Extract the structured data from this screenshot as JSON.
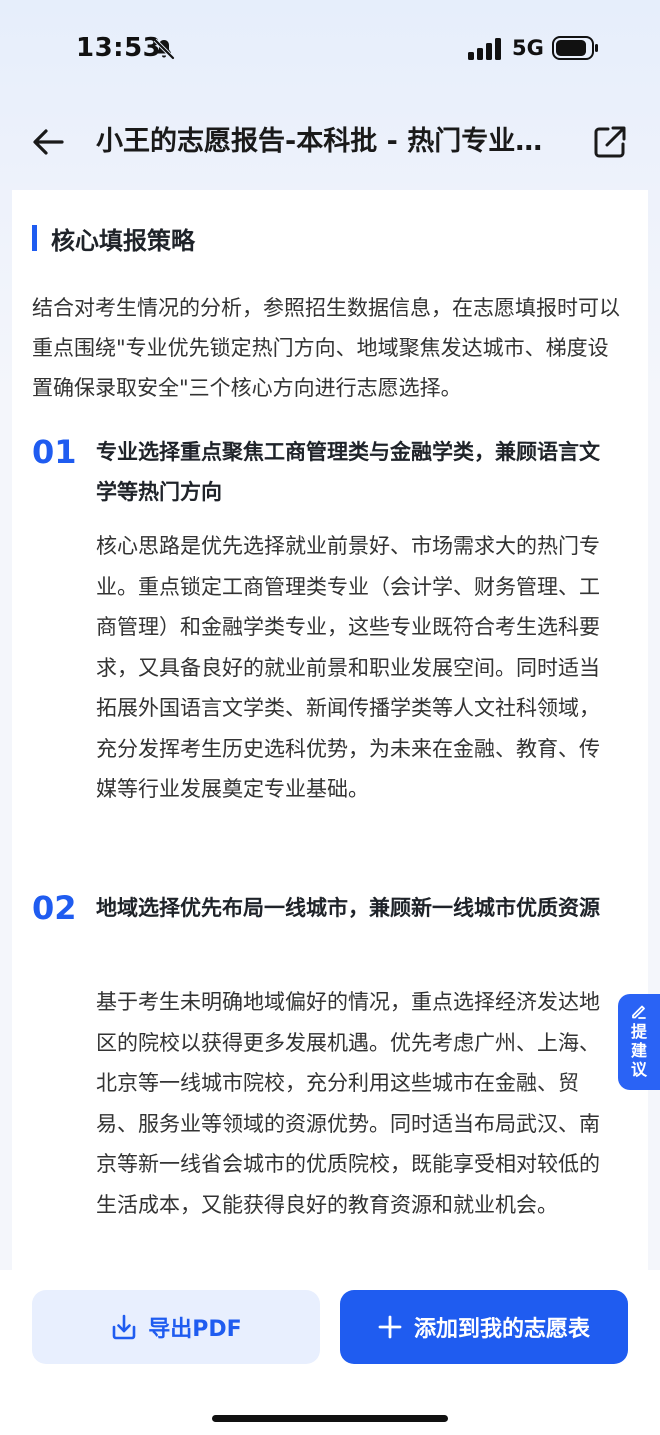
{
  "status_bar": {
    "time": "13:53",
    "network": "5G"
  },
  "header": {
    "title": "小王的志愿报告-本科批 - 热门专业方向"
  },
  "section": {
    "title": "核心填报策略",
    "intro": "结合对考生情况的分析，参照招生数据信息，在志愿填报时可以重点围绕\"专业优先锁定热门方向、地域聚焦发达城市、梯度设置确保录取安全\"三个核心方向进行志愿选择。"
  },
  "items": [
    {
      "num": "01",
      "title": "专业选择重点聚焦工商管理类与金融学类，兼顾语言文学等热门方向",
      "body": "核心思路是优先选择就业前景好、市场需求大的热门专业。重点锁定工商管理类专业（会计学、财务管理、工商管理）和金融学类专业，这些专业既符合考生选科要求，又具备良好的就业前景和职业发展空间。同时适当拓展外国语言文学类、新闻传播学类等人文社科领域，充分发挥考生历史选科优势，为未来在金融、教育、传媒等行业发展奠定专业基础。"
    },
    {
      "num": "02",
      "title": "地域选择优先布局一线城市，兼顾新一线城市优质资源",
      "body": "基于考生未明确地域偏好的情况，重点选择经济发达地区的院校以获得更多发展机遇。优先考虑广州、上海、北京等一线城市院校，充分利用这些城市在金融、贸易、服务业等领域的资源优势。同时适当布局武汉、南京等新一线省会城市的优质院校，既能享受相对较低的生活成本，又能获得良好的教育资源和就业机会。"
    }
  ],
  "feedback_tab": {
    "label": "提建议"
  },
  "actions": {
    "export_label": "导出PDF",
    "add_label": "添加到我的志愿表"
  },
  "colors": {
    "accent": "#1f5cf0",
    "export_bg": "#e8effe"
  },
  "icons": {
    "back": "arrow-left",
    "share": "external-link",
    "bell": "bell-off",
    "export": "download",
    "add": "plus",
    "feedback": "pencil"
  }
}
